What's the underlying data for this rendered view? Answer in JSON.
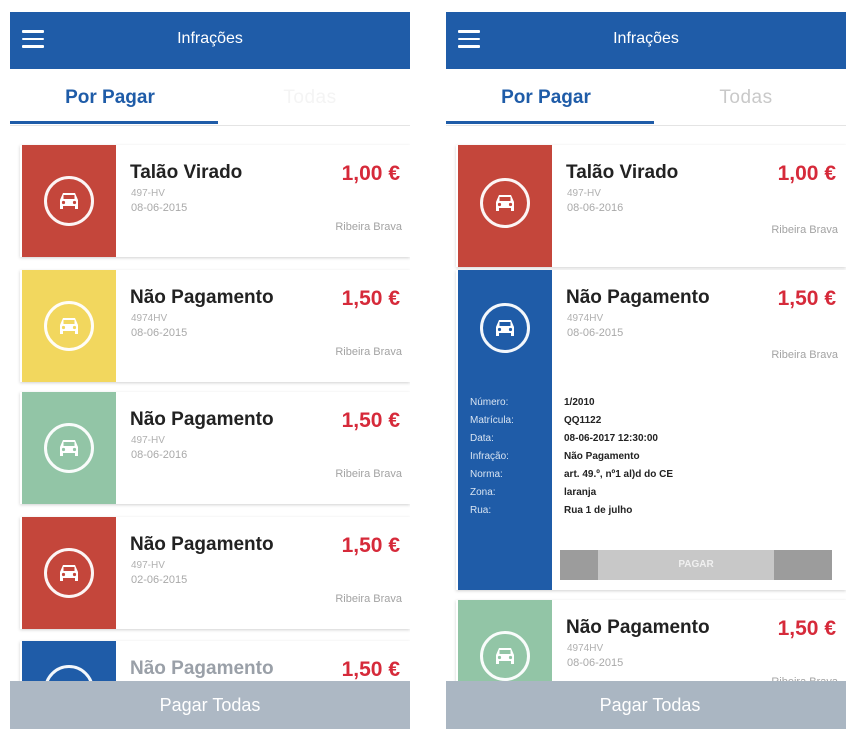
{
  "screens": {
    "left": {
      "appbar": {
        "title": "Infrações",
        "menu_icon": "menu-icon"
      },
      "tabs": [
        "Por Pagar",
        "Todas"
      ],
      "cards": [
        {
          "title": "Talão Virado",
          "plate": "497-HV",
          "date": "08-06-2015",
          "price": "1,00 €",
          "location": "Ribeira Brava",
          "color": "#c4463b"
        },
        {
          "title": "Não Pagamento",
          "plate": "4974HV",
          "date": "08-06-2015",
          "price": "1,50 €",
          "location": "Ribeira Brava",
          "color": "#f2d75e"
        },
        {
          "title": "Não Pagamento",
          "plate": "497-HV",
          "date": "08-06-2016",
          "price": "1,50 €",
          "location": "Ribeira Brava",
          "color": "#92c5a6"
        },
        {
          "title": "Não Pagamento",
          "plate": "497-HV",
          "date": "02-06-2015",
          "price": "1,50 €",
          "location": "Ribeira Brava",
          "color": "#c4463b"
        },
        {
          "title": "Não Pagamento",
          "plate": "",
          "date": "",
          "price": "1,50 €",
          "location": "",
          "color": "#1f5ca8"
        }
      ],
      "bottom_button": "Pagar Todas"
    },
    "right": {
      "appbar": {
        "title": "Infrações",
        "menu_icon": "menu-icon"
      },
      "tabs": [
        "Por Pagar",
        "Todas"
      ],
      "cards": [
        {
          "title": "Talão Virado",
          "plate": "497-HV",
          "date": "08-06-2016",
          "price": "1,00 €",
          "location": "Ribeira Brava",
          "color": "#c4463b"
        },
        {
          "title": "Não Pagamento",
          "plate": "4974HV",
          "date": "08-06-2015",
          "price": "1,50 €",
          "location": "Ribeira Brava",
          "color": "#1f5ca8"
        },
        {
          "title": "Não Pagamento",
          "plate": "4974HV",
          "date": "08-06-2015",
          "price": "1,50 €",
          "location": "Ribeira Brava",
          "color": "#92c5a6"
        }
      ],
      "details": [
        {
          "label": "Número:",
          "value": "1/2010"
        },
        {
          "label": "Matrícula:",
          "value": "QQ1122"
        },
        {
          "label": "Data:",
          "value": "08-06-2017  12:30:00"
        },
        {
          "label": "Infração:",
          "value": "Não Pagamento"
        },
        {
          "label": "Norma:",
          "value": "art. 49.º, nº1  al)d do CE"
        },
        {
          "label": "Zona:",
          "value": "laranja"
        },
        {
          "label": "Rua:",
          "value": "Rua 1 de julho"
        }
      ],
      "pay_button": "PAGAR",
      "bottom_button": "Pagar Todas"
    }
  },
  "icons": {
    "car": "car-icon",
    "menu": "menu-icon"
  }
}
